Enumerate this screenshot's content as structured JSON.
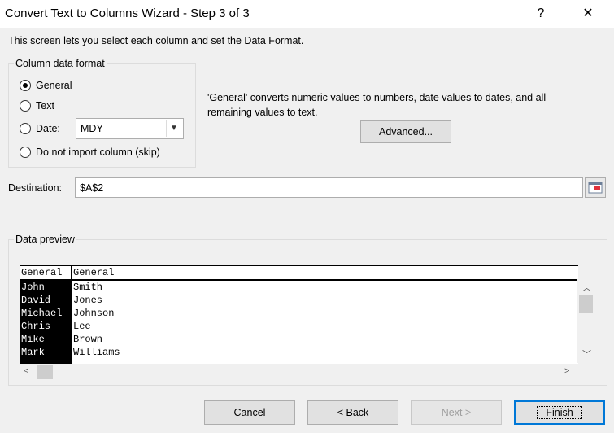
{
  "window": {
    "title": "Convert Text to Columns Wizard - Step 3 of 3",
    "help_label": "?",
    "close_label": "✕"
  },
  "description": "This screen lets you select each column and set the Data Format.",
  "column_format": {
    "group_label": "Column data format",
    "options": [
      {
        "label": "General",
        "selected": true
      },
      {
        "label": "Text",
        "selected": false
      },
      {
        "label": "Date:",
        "selected": false
      },
      {
        "label": "Do not import column (skip)",
        "selected": false
      }
    ],
    "date_format_value": "MDY"
  },
  "info_text": "'General' converts numeric values to numbers, date values to dates, and all remaining values to text.",
  "advanced_label": "Advanced...",
  "destination": {
    "label": "Destination:",
    "value": "$A$2"
  },
  "preview": {
    "group_label": "Data preview",
    "headers": [
      "General",
      "General"
    ],
    "rows": [
      [
        "John",
        "Smith"
      ],
      [
        "David",
        "Jones"
      ],
      [
        "Michael",
        "Johnson"
      ],
      [
        "Chris",
        "Lee"
      ],
      [
        "Mike",
        "Brown"
      ],
      [
        "Mark",
        "Williams"
      ]
    ]
  },
  "buttons": {
    "cancel": "Cancel",
    "back": "< Back",
    "next": "Next >",
    "finish": "Finish"
  },
  "icons": [
    "help-icon",
    "close-icon",
    "chevron-down-icon",
    "collapse-dialog-icon",
    "scroll-up-icon",
    "scroll-down-icon",
    "scroll-left-icon",
    "scroll-right-icon"
  ]
}
